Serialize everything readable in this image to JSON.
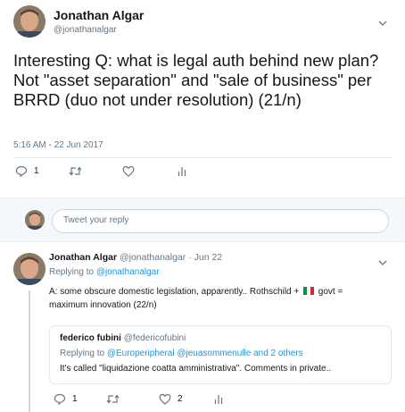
{
  "main_tweet": {
    "author_name": "Jonathan Algar",
    "author_handle": "@jonathanalgar",
    "text": "Interesting Q: what is legal auth behind new plan? Not \"asset separation\" and \"sale of business\" per BRRD (duo not under resolution) (21/n)",
    "timestamp": "5:16 AM - 22 Jun 2017",
    "reply_count": "1"
  },
  "reply_box": {
    "placeholder": "Tweet your reply"
  },
  "reply_tweet": {
    "author_name": "Jonathan Algar",
    "author_handle": "@jonathanalgar",
    "separator": "·",
    "date": "Jun 22",
    "replying_prefix": "Replying to",
    "replying_to": "@jonathanalgar",
    "text_before_flag": "A: some obscure domestic legislation, apparently.. Rothschild +",
    "text_after_flag": "govt =",
    "text_line2": "maximum innovation (22/n)",
    "reply_count": "1",
    "like_count": "2",
    "flag_colors": [
      "#009246",
      "#ffffff",
      "#ce2b37"
    ]
  },
  "quoted_tweet": {
    "author_name": "federico fubini",
    "author_handle": "@federicofubini",
    "replying_prefix": "Replying to",
    "replying_to": "@Europeripheral @jeuasommenulle and 2 others",
    "text": "It's called \"liquidazione coatta amministrativa\". Comments in private.."
  },
  "icons": {
    "reply": "reply-icon",
    "retweet": "retweet-icon",
    "like": "heart-icon",
    "analytics": "analytics-icon",
    "caret": "chevron-down-icon"
  },
  "colors": {
    "accent": "#1b95e0",
    "muted": "#657786",
    "text": "#14171a",
    "reply_bar_bg": "#f5f8fa"
  }
}
